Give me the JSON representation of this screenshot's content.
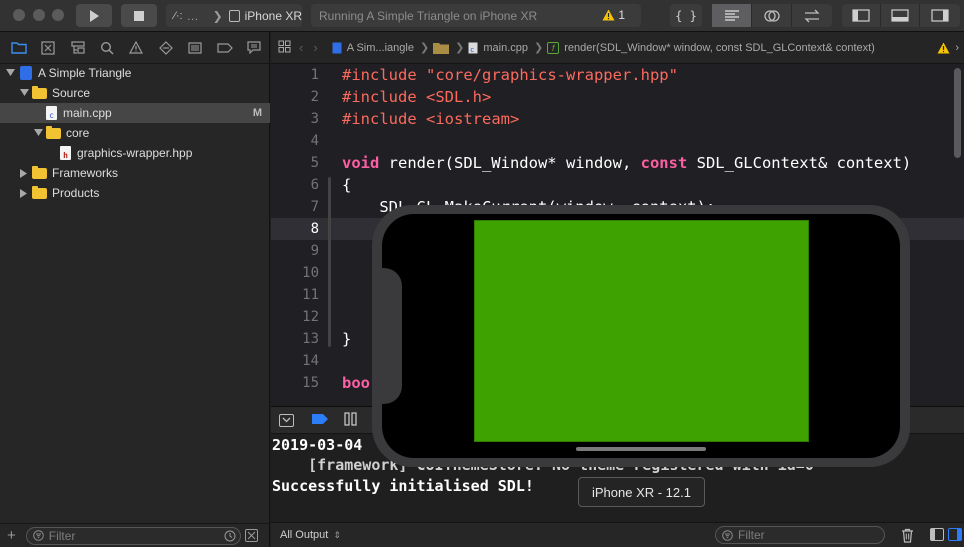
{
  "toolbar": {
    "scheme_target": "iPhone XR",
    "activity_status": "Running A Simple Triangle on iPhone XR",
    "warning_count": "1",
    "library_label": "{ }"
  },
  "jumpbar": {
    "crumbs": [
      "A Sim...iangle",
      "main.cpp",
      "render(SDL_Window* window, const SDL_GLContext& context)"
    ]
  },
  "navigator": {
    "items": [
      {
        "label": "A Simple Triangle"
      },
      {
        "label": "Source"
      },
      {
        "label": "main.cpp",
        "badge": "M"
      },
      {
        "label": "core"
      },
      {
        "label": "graphics-wrapper.hpp"
      },
      {
        "label": "Frameworks"
      },
      {
        "label": "Products"
      }
    ],
    "filter_placeholder": "Filter"
  },
  "editor": {
    "line_numbers": [
      "1",
      "2",
      "3",
      "4",
      "5",
      "6",
      "7",
      "8",
      "9",
      "10",
      "11",
      "12",
      "13",
      "14",
      "15"
    ],
    "current_line": 8,
    "lines": {
      "l1_kw": "#include ",
      "l1_str": "\"core/graphics-wrapper.hpp\"",
      "l2_kw": "#include ",
      "l2_str": "<SDL.h>",
      "l3_kw": "#include ",
      "l3_str": "<iostream>",
      "l5_kw1": "void",
      "l5_a": " render(SDL_Window* window, ",
      "l5_kw2": "const",
      "l5_b": " SDL_GLContext& context)",
      "l6": "{",
      "l7": "    SDL_GL_MakeCurrent(window, context);",
      "l13": "}",
      "l15_kw": "boo"
    }
  },
  "console": {
    "lines": [
      "2019-03-04",
      "    [framework] CUIThemeStore: No theme registered with id=0",
      "Successfully initialised SDL!"
    ],
    "output_selector": "All Output",
    "filter_placeholder": "Filter"
  },
  "simulator": {
    "tooltip": "iPhone XR - 12.1",
    "sdl_clear_color": "#3ea300"
  }
}
